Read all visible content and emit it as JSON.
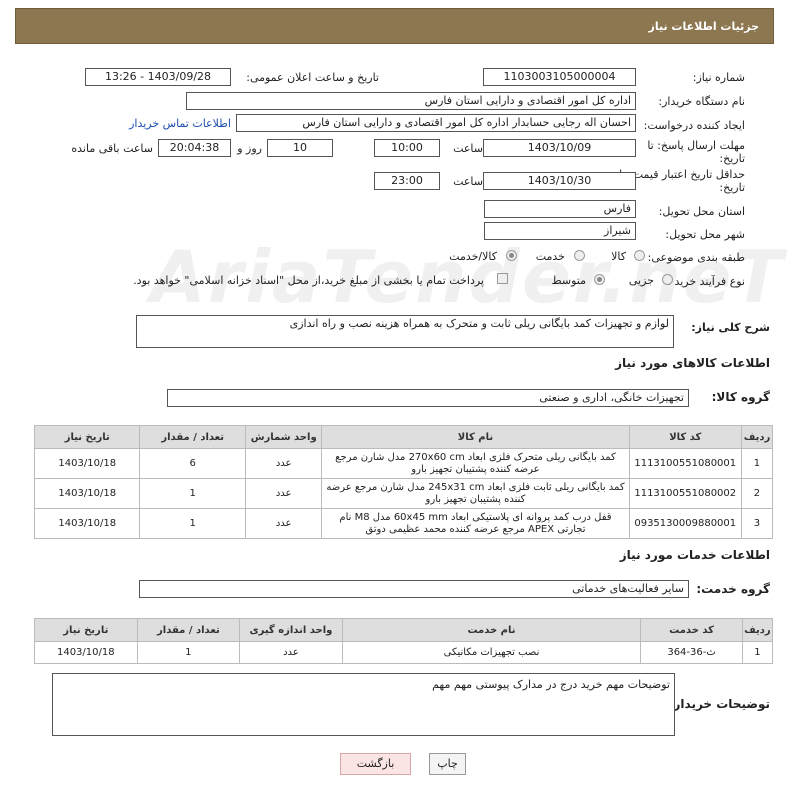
{
  "header": {
    "title": "جزئیات اطلاعات نیاز"
  },
  "form": {
    "need_number_label": "شماره نیاز:",
    "need_number": "1103003105000004",
    "announce_label": "تاریخ و ساعت اعلان عمومی:",
    "announce_value": "1403/09/28 - 13:26",
    "buyer_label": "نام دستگاه خریدار:",
    "buyer_value": "اداره کل امور اقتصادی و دارایی استان فارس",
    "creator_label": "ایجاد کننده درخواست:",
    "creator_value": "احسان اله  رجایی حسابدار اداره کل امور اقتصادی و دارایی استان فارس",
    "contact_link": "اطلاعات تماس خریدار",
    "deadline_label_1": "مهلت ارسال پاسخ: تا",
    "deadline_label_2": "تاریخ:",
    "deadline_date": "1403/10/09",
    "time_label": "ساعت",
    "deadline_time": "10:00",
    "days_value": "10",
    "days_label": "روز و",
    "remaining_time": "20:04:38",
    "remaining_label": "ساعت باقی مانده",
    "validity_label_1": "حداقل تاریخ اعتبار قیمت: تا",
    "validity_label_2": "تاریخ:",
    "validity_date": "1403/10/30",
    "validity_time": "23:00",
    "province_label": "استان محل تحویل:",
    "province_value": "فارس",
    "city_label": "شهر محل تحویل:",
    "city_value": "شیراز",
    "category_label": "طبقه بندی موضوعی:",
    "category_options": [
      "کالا",
      "خدمت",
      "کالا/خدمت"
    ],
    "purchase_type_label": "نوع فرآیند خرید :",
    "purchase_options": [
      "جزیی",
      "متوسط"
    ],
    "payment_note": "پرداخت تمام یا بخشی از مبلغ خرید،از محل \"اسناد خزانه اسلامی\" خواهد بود."
  },
  "description": {
    "label": "شرح کلی نیاز:",
    "value": "لوازم و تجهیزات کمد بایگانی ریلی ثابت و متحرک به همراه هزینه نصب و راه اندازی"
  },
  "goods_section": {
    "title": "اطلاعات کالاهای مورد نیاز",
    "group_label": "گروه کالا:",
    "group_value": "تجهیزات خانگی، اداری و صنعتی",
    "columns": [
      "ردیف",
      "کد کالا",
      "نام کالا",
      "واحد شمارش",
      "تعداد / مقدار",
      "تاریخ نیاز"
    ],
    "rows": [
      {
        "row": "1",
        "code": "1113100551080001",
        "name": "کمد بایگانی ریلی متحرک فلزی ابعاد 270x60 cm مدل شارن مرجع عرضه کننده پشتیبان تجهیز بارو",
        "unit": "عدد",
        "qty": "6",
        "date": "1403/10/18"
      },
      {
        "row": "2",
        "code": "1113100551080002",
        "name": "کمد بایگانی ریلی ثابت فلزی ابعاد 245x31 cm مدل شارن مرجع عرضه کننده پشتیبان تجهیز بارو",
        "unit": "عدد",
        "qty": "1",
        "date": "1403/10/18"
      },
      {
        "row": "3",
        "code": "0935130009880001",
        "name": "قفل درب کمد پروانه ای پلاستیکی ابعاد 60x45 mm مدل M8 نام تجارتی APEX مرجع عرضه کننده محمد عظیمی دوتق",
        "unit": "عدد",
        "qty": "1",
        "date": "1403/10/18"
      }
    ]
  },
  "services_section": {
    "title": "اطلاعات خدمات مورد نیاز",
    "group_label": "گروه خدمت:",
    "group_value": "سایر فعالیت‌های خدماتی",
    "columns": [
      "ردیف",
      "کد خدمت",
      "نام خدمت",
      "واحد اندازه گیری",
      "تعداد / مقدار",
      "تاریخ نیاز"
    ],
    "rows": [
      {
        "row": "1",
        "code": "ث-36-364",
        "name": "نصب تجهیزات مکانیکی",
        "unit": "عدد",
        "qty": "1",
        "date": "1403/10/18"
      }
    ]
  },
  "buyer_notes": {
    "label": "توضیحات خریدار:",
    "value": "توضیحات مهم خرید درج در مدارک پیوستی مهم مهم"
  },
  "buttons": {
    "print": "چاپ",
    "back": "بازگشت"
  },
  "watermark": "AriaTender.neT"
}
